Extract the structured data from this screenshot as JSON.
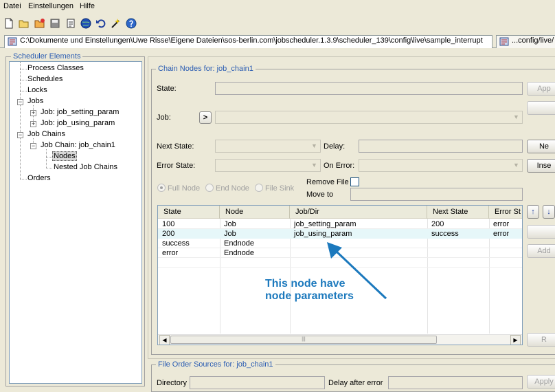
{
  "menu": [
    "Datei",
    "Einstellungen",
    "Hilfe"
  ],
  "toolbar_icons": [
    "new-file-icon",
    "open-folder-icon",
    "open-remote-folder-icon",
    "save-icon",
    "save-as-icon",
    "globe-icon",
    "undo-icon",
    "wizard-icon",
    "help-icon"
  ],
  "tabs": [
    {
      "label": "C:\\Dokumente und Einstellungen\\Uwe Risse\\Eigene Dateien\\sos-berlin.com\\jobscheduler.1.3.9\\scheduler_139\\config\\live\\sample_interrupt"
    },
    {
      "label": "...config/live/"
    }
  ],
  "tree": {
    "title": "Scheduler Elements",
    "items": {
      "process_classes": "Process Classes",
      "schedules": "Schedules",
      "locks": "Locks",
      "jobs": "Jobs",
      "job_setting": "Job: job_setting_param",
      "job_using": "Job: job_using_param",
      "job_chains": "Job Chains",
      "job_chain1": "Job Chain: job_chain1",
      "nodes": "Nodes",
      "nested": "Nested Job Chains",
      "orders": "Orders"
    },
    "expanders": {
      "jobs": "−",
      "job_setting": "+",
      "job_using": "+",
      "job_chains": "−",
      "job_chain1": "−"
    }
  },
  "chain_nodes": {
    "title": "Chain Nodes for: job_chain1",
    "state_label": "State:",
    "job_label": "Job:",
    "job_picker": ">",
    "next_state_label": "Next State:",
    "delay_label": "Delay:",
    "error_state_label": "Error State:",
    "on_error_label": "On Error:",
    "radio_full": "Full Node",
    "radio_end": "End Node",
    "radio_sink": "File Sink",
    "remove_file_label": "Remove File",
    "move_to_label": "Move to",
    "buttons": {
      "apply": "App",
      "new": "Ne",
      "insert": "Inse",
      "add": "Add",
      "remove": "R"
    },
    "combo_arrow": "▼"
  },
  "table": {
    "columns": [
      "State",
      "Node",
      "Job/Dir",
      "Next State",
      "Error St"
    ],
    "rows": [
      [
        "100",
        "Job",
        "job_setting_param",
        "200",
        "error"
      ],
      [
        "200",
        "Job",
        "job_using_param",
        "success",
        "error"
      ],
      [
        "success",
        "Endnode",
        "",
        "",
        ""
      ],
      [
        "error",
        "Endnode",
        "",
        "",
        ""
      ]
    ],
    "selected_row": 1,
    "scroll_left": "◀",
    "scroll_right": "▶",
    "thumb_grip": "|||"
  },
  "move_buttons": {
    "up": "↑",
    "down": "↓"
  },
  "annotation": {
    "line1": "This node have",
    "line2": "node parameters",
    "color": "#1c79bd"
  },
  "file_order": {
    "title": "File Order Sources for: job_chain1",
    "directory_label": "Directory",
    "delay_after_error_label": "Delay after error",
    "apply": "Apply"
  }
}
